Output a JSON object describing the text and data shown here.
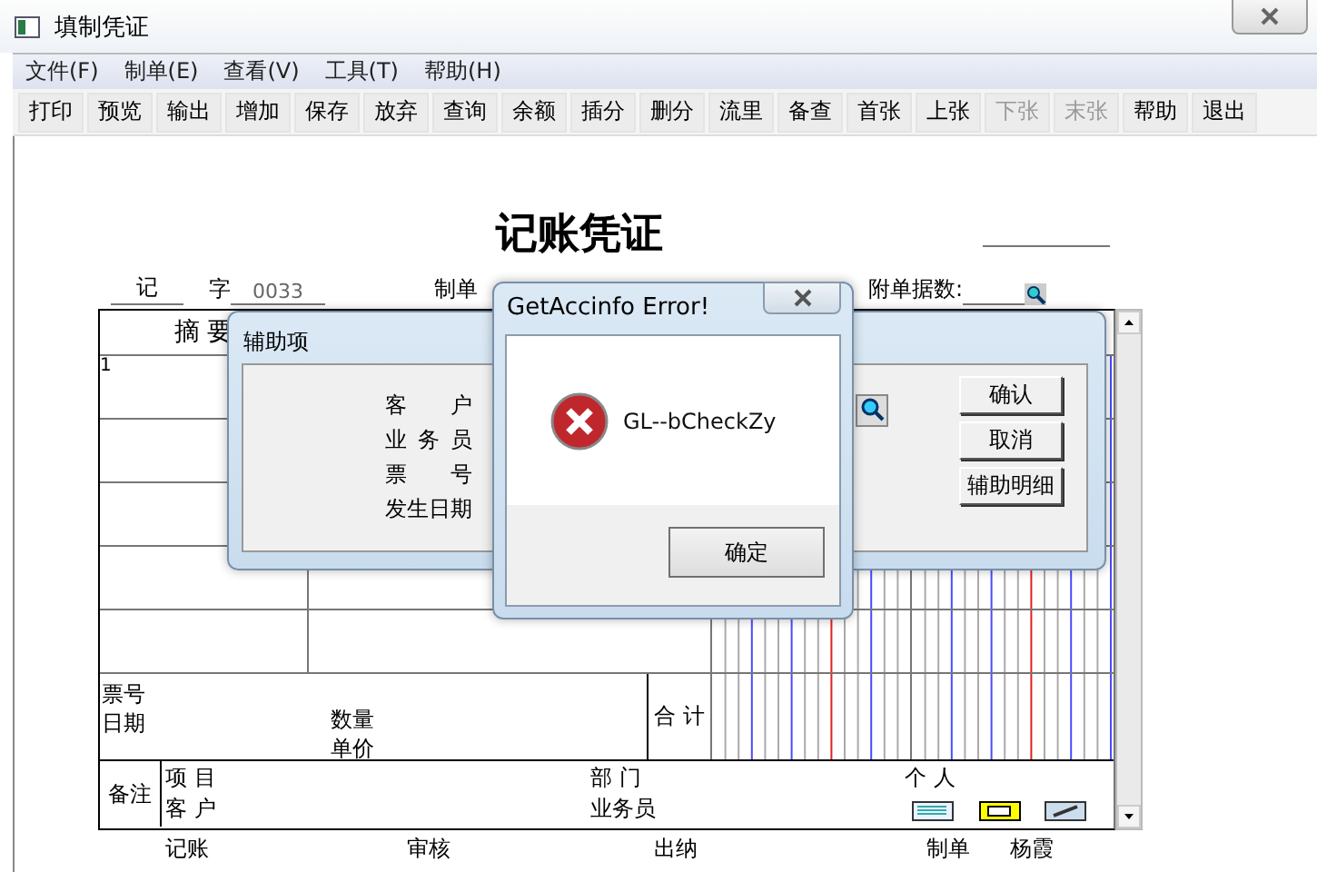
{
  "window": {
    "title": "填制凭证"
  },
  "menu": [
    "文件(F)",
    "制单(E)",
    "查看(V)",
    "工具(T)",
    "帮助(H)"
  ],
  "toolbar": [
    {
      "label": "打印",
      "disabled": false
    },
    {
      "label": "预览",
      "disabled": false
    },
    {
      "label": "输出",
      "disabled": false
    },
    {
      "label": "增加",
      "disabled": false
    },
    {
      "label": "保存",
      "disabled": false
    },
    {
      "label": "放弃",
      "disabled": false
    },
    {
      "label": "查询",
      "disabled": false
    },
    {
      "label": "余额",
      "disabled": false
    },
    {
      "label": "插分",
      "disabled": false
    },
    {
      "label": "删分",
      "disabled": false
    },
    {
      "label": "流里",
      "disabled": false
    },
    {
      "label": "备查",
      "disabled": false
    },
    {
      "label": "首张",
      "disabled": false
    },
    {
      "label": "上张",
      "disabled": false
    },
    {
      "label": "下张",
      "disabled": true
    },
    {
      "label": "末张",
      "disabled": true
    },
    {
      "label": "帮助",
      "disabled": false
    },
    {
      "label": "退出",
      "disabled": false
    }
  ],
  "voucher": {
    "title": "记账凭证",
    "type_label": "记",
    "word_label": "字",
    "number": "0033",
    "date_label": "制单",
    "attachments_label": "附单据数:",
    "summary_header": "摘 要",
    "rows": [
      {
        "line": "1"
      }
    ],
    "ticket_label": "票号",
    "date_label2": "日期",
    "quantity_label": "数量",
    "price_label": "单价",
    "total_label": "合 计",
    "remarks": {
      "label": "备注",
      "project": "项 目",
      "customer": "客 户",
      "department": "部 门",
      "salesperson": "业务员",
      "person": "个 人"
    }
  },
  "signatures": [
    {
      "label": "记账"
    },
    {
      "label": "审核"
    },
    {
      "label": "出纳"
    },
    {
      "label": "制单",
      "value": "杨霞"
    }
  ],
  "aux_dialog": {
    "title": "辅助项",
    "fields": [
      "客 户",
      "业 务 员",
      "票 号",
      "发生日期"
    ],
    "buttons": [
      "确认",
      "取消",
      "辅助明细"
    ]
  },
  "error_dialog": {
    "title": "GetAccinfo Error!",
    "message": "GL--bCheckZy",
    "button": "确定"
  }
}
